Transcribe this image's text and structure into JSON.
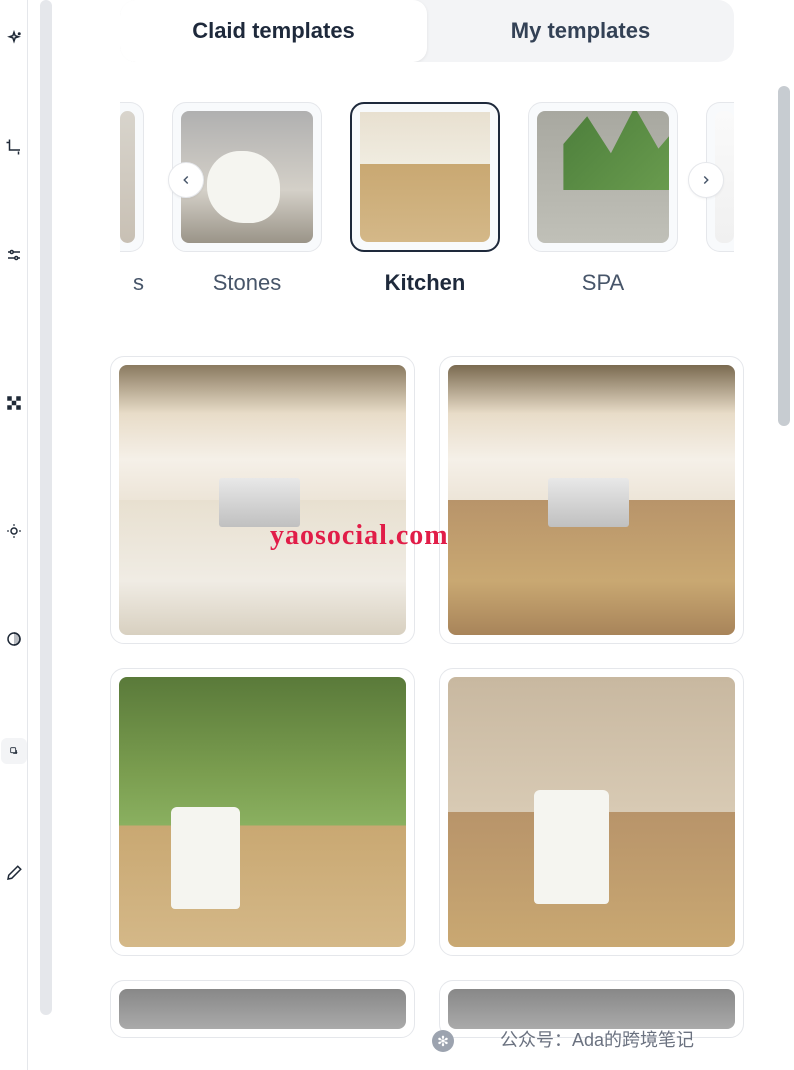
{
  "tabs": {
    "claid": "Claid templates",
    "my": "My templates",
    "active": "claid"
  },
  "categories": {
    "partial_left_label": "s",
    "items": [
      {
        "label": "Stones",
        "selected": false
      },
      {
        "label": "Kitchen",
        "selected": true
      },
      {
        "label": "SPA",
        "selected": false
      }
    ]
  },
  "watermark": "yaosocial.com",
  "footer": "公众号：Ada的跨境笔记"
}
